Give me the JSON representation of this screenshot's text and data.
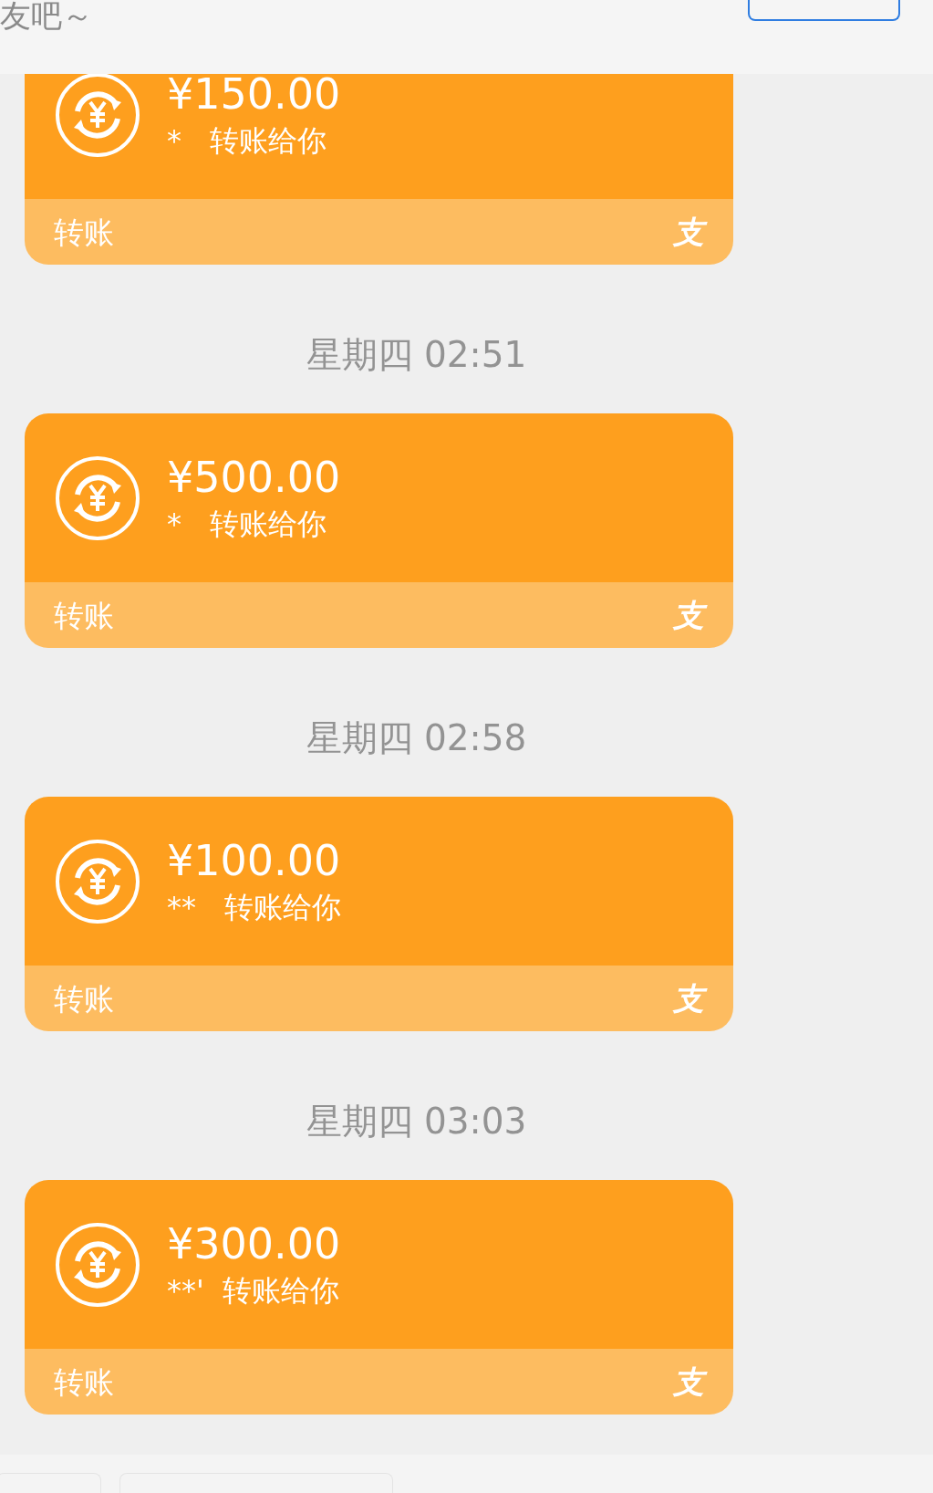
{
  "banner": {
    "text": "友吧～"
  },
  "messages": [
    {
      "amount": "¥150.00",
      "note": "*   转账给你",
      "label": "转账",
      "mark": "支"
    },
    {
      "time": "星期四 02:51",
      "amount": "¥500.00",
      "note": "*   转账给你",
      "label": "转账",
      "mark": "支"
    },
    {
      "time": "星期四 02:58",
      "amount": "¥100.00",
      "note": "**   转账给你",
      "label": "转账",
      "mark": "支"
    },
    {
      "time": "星期四 03:03",
      "amount": "¥300.00",
      "note": "**'  转账给你",
      "label": "转账",
      "mark": "支"
    }
  ]
}
